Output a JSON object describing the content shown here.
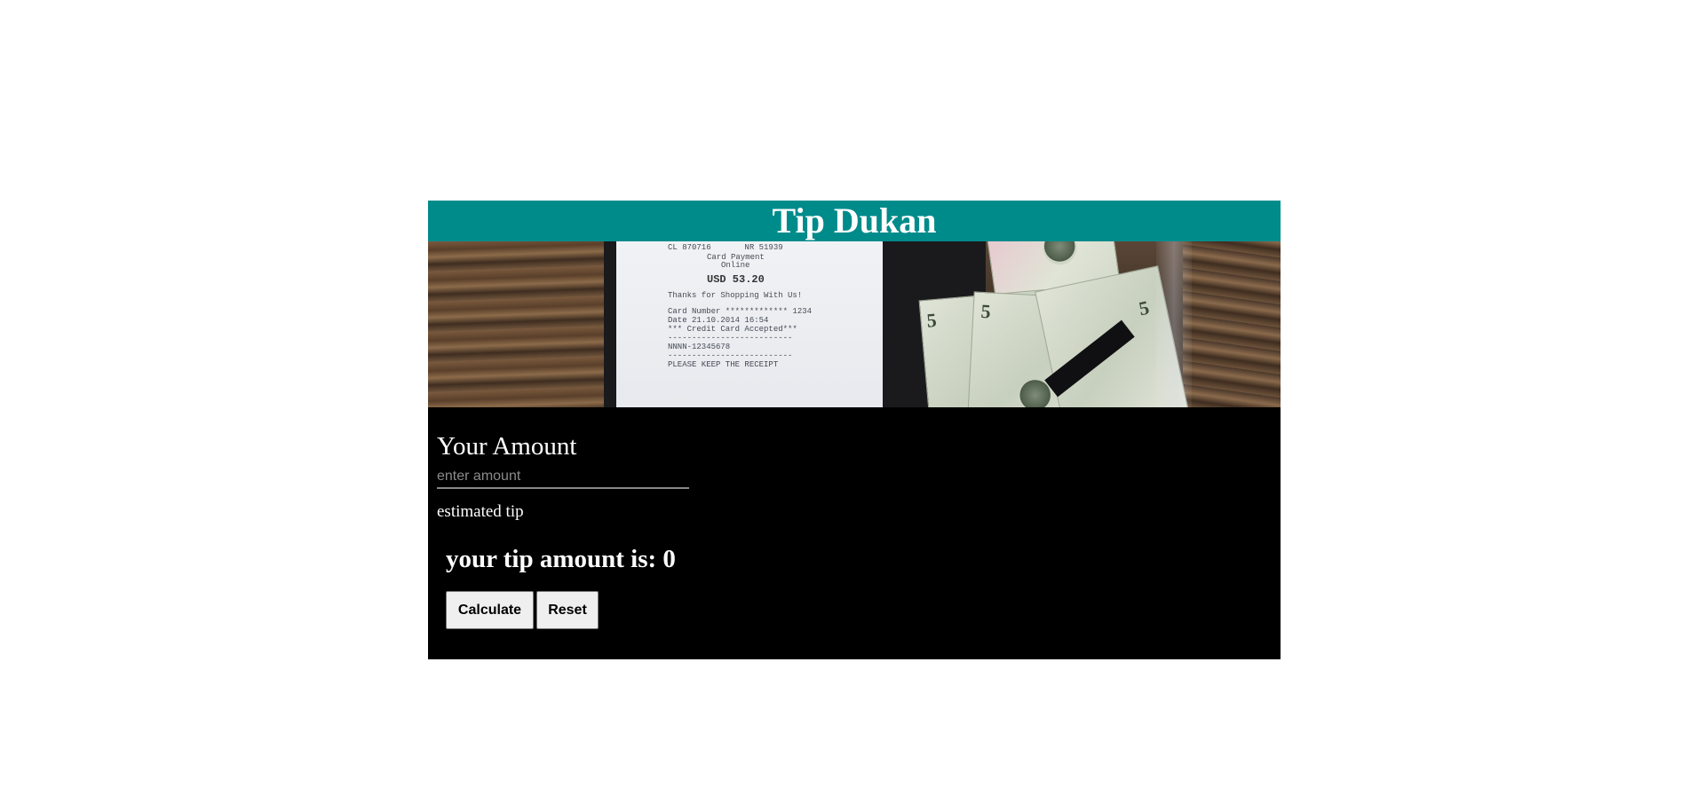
{
  "header": {
    "title": "Tip Dukan",
    "background": "#008b8b"
  },
  "banner": {
    "receipt_lines": [
      "CL 870716       NR 51939",
      "Card Payment",
      "Online",
      "USD 53.20",
      "Thanks for Shopping With Us!",
      "Card Number ************* 1234",
      "Date 21.10.2014 16:54",
      "*** Credit Card Accepted***",
      "--------------------------",
      "NNNN-12345678",
      "--------------------------",
      "PLEASE KEEP THE RECEIPT"
    ],
    "bill_numbers": [
      "5",
      "5",
      "5"
    ]
  },
  "form": {
    "amount_title": "Your Amount",
    "amount_value": "",
    "amount_placeholder": "enter amount",
    "estimated_tip_label": "estimated tip",
    "result_label": "your tip amount is:",
    "result_value": "0"
  },
  "buttons": {
    "calculate_label": "Calculate",
    "reset_label": "Reset"
  }
}
